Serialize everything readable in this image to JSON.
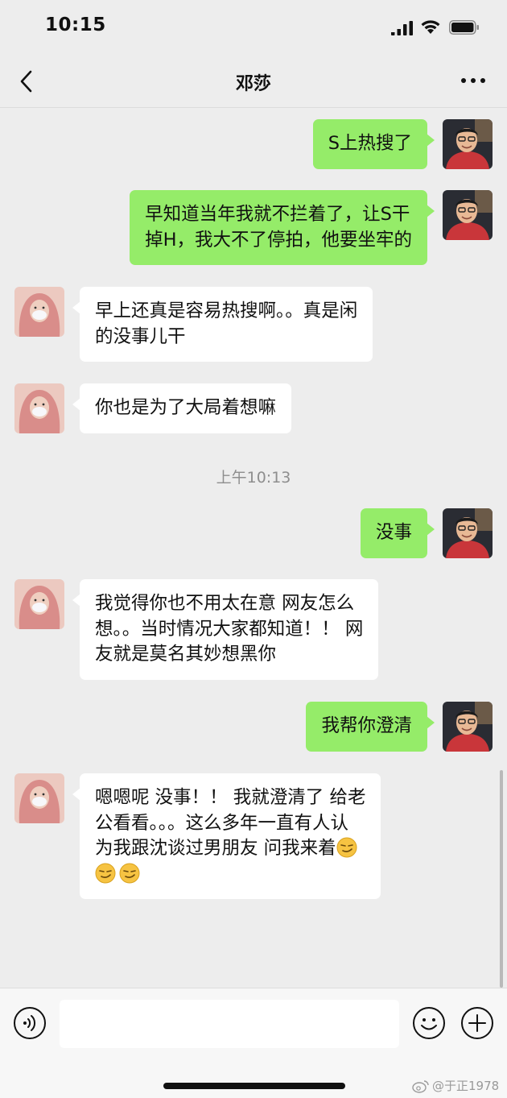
{
  "status_bar": {
    "time": "10:15"
  },
  "nav": {
    "title": "邓莎"
  },
  "messages": [
    {
      "side": "out",
      "lines": [
        "S上热搜了"
      ]
    },
    {
      "side": "out",
      "lines": [
        "早知道当年我就不拦着了，让S干",
        "掉H，我大不了停拍，他要坐牢的"
      ]
    },
    {
      "side": "in",
      "lines": [
        "早上还真是容易热搜啊。。真是闲",
        "的没事儿干"
      ]
    },
    {
      "side": "in",
      "lines": [
        "你也是为了大局着想嘛"
      ]
    },
    {
      "side": "out",
      "lines": [
        "没事"
      ]
    },
    {
      "side": "in",
      "lines": [
        "我觉得你也不用太在意 网友怎么",
        "想。。当时情况大家都知道！！ 网",
        "友就是莫名其妙想黑你"
      ]
    },
    {
      "side": "out",
      "lines": [
        "我帮你澄清"
      ]
    },
    {
      "side": "in",
      "lines": [
        "嗯嗯呢 没事！！ 我就澄清了 给老",
        "公看看。。。这么多年一直有人认",
        "为我跟沈谈过男朋友 问我来着"
      ],
      "trailing_emoji": "smirk-emoji"
    }
  ],
  "timestamp": "上午10:13",
  "input": {
    "value": ""
  },
  "watermark": "@于正1978",
  "colors": {
    "outgoing_bubble": "#95ec69",
    "incoming_bubble": "#ffffff",
    "background": "#ededed"
  },
  "icons": [
    "back-icon",
    "more-icon",
    "voice-icon",
    "emoji-icon",
    "plus-icon",
    "weibo-icon"
  ]
}
